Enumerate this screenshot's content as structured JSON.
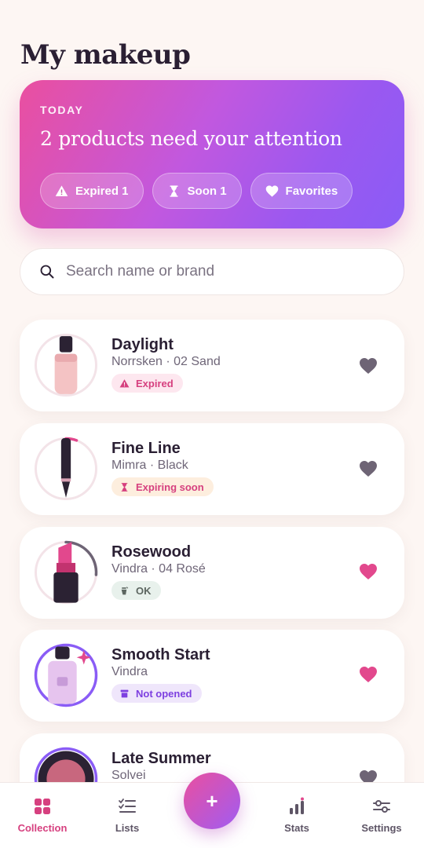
{
  "page": {
    "title": "My makeup"
  },
  "hero": {
    "kicker": "TODAY",
    "headline": "2 products need your attention",
    "chips": [
      {
        "label": "Expired 1",
        "icon": "warning-icon"
      },
      {
        "label": "Soon 1",
        "icon": "hourglass-icon"
      },
      {
        "label": "Favorites",
        "icon": "heart-icon"
      }
    ]
  },
  "search": {
    "placeholder": "Search name or brand",
    "value": ""
  },
  "products": [
    {
      "name": "Daylight",
      "subtitle": "Norrsken · 02 Sand",
      "status": "Expired",
      "status_icon": "warning-icon",
      "favorite": false,
      "icon": "foundation-bottle-icon",
      "usage": 0.0
    },
    {
      "name": "Fine Line",
      "subtitle": "Mimra · Black",
      "status": "Expiring soon",
      "status_icon": "hourglass-icon",
      "favorite": false,
      "icon": "eyeliner-icon",
      "usage": 0.04
    },
    {
      "name": "Rosewood",
      "subtitle": "Vindra · 04 Rosé",
      "status": "OK",
      "status_icon": "jar-icon",
      "favorite": true,
      "icon": "lipstick-icon",
      "usage": 0.28
    },
    {
      "name": "Smooth Start",
      "subtitle": "Vindra",
      "status": "Not opened",
      "status_icon": "box-icon",
      "favorite": true,
      "icon": "primer-tube-icon",
      "usage": 1.0
    },
    {
      "name": "Late Summer",
      "subtitle": "Solvei",
      "status": "",
      "status_icon": "",
      "favorite": false,
      "icon": "powder-compact-icon",
      "usage": 1.0
    }
  ],
  "nav": {
    "items": [
      {
        "label": "Collection",
        "icon": "grid-icon",
        "active": true
      },
      {
        "label": "Lists",
        "icon": "checklist-icon",
        "active": false
      },
      {
        "label": "Stats",
        "icon": "bar-chart-icon",
        "active": false
      },
      {
        "label": "Settings",
        "icon": "sliders-icon",
        "active": false
      }
    ],
    "fab_label": "+"
  },
  "colors": {
    "accent_pink": "#d6407f",
    "accent_purple": "#8a5cf6",
    "heart_active": "#e2488d",
    "heart_inactive": "#6e6475",
    "background": "#fdf6f3"
  }
}
